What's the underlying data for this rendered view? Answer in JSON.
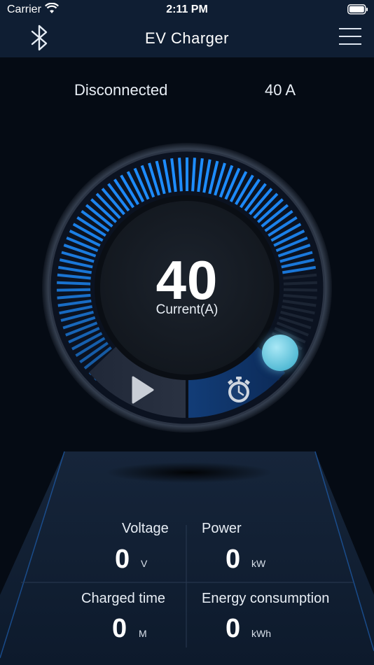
{
  "status_bar": {
    "carrier": "Carrier",
    "time": "2:11 PM"
  },
  "nav": {
    "title": "EV Charger",
    "left_icon": "bluetooth-icon",
    "right_icon": "hamburger-menu-icon"
  },
  "connection": {
    "status": "Disconnected",
    "amps": "40 A"
  },
  "gauge": {
    "value": "40",
    "label": "Current(A)",
    "level_fraction": 0.8
  },
  "controls": {
    "play_icon": "play-icon",
    "timer_icon": "stopwatch-icon"
  },
  "stats": {
    "voltage": {
      "label": "Voltage",
      "value": "0",
      "unit": "V"
    },
    "power": {
      "label": "Power",
      "value": "0",
      "unit": "kW"
    },
    "charged_time": {
      "label": "Charged time",
      "value": "0",
      "unit": "M"
    },
    "energy": {
      "label": "Energy consumption",
      "value": "0",
      "unit": "kWh"
    }
  },
  "colors": {
    "accent": "#1e8dff",
    "nav_bg": "#0f1e33",
    "bg": "#050b14",
    "knob": "#6fcbe2"
  }
}
